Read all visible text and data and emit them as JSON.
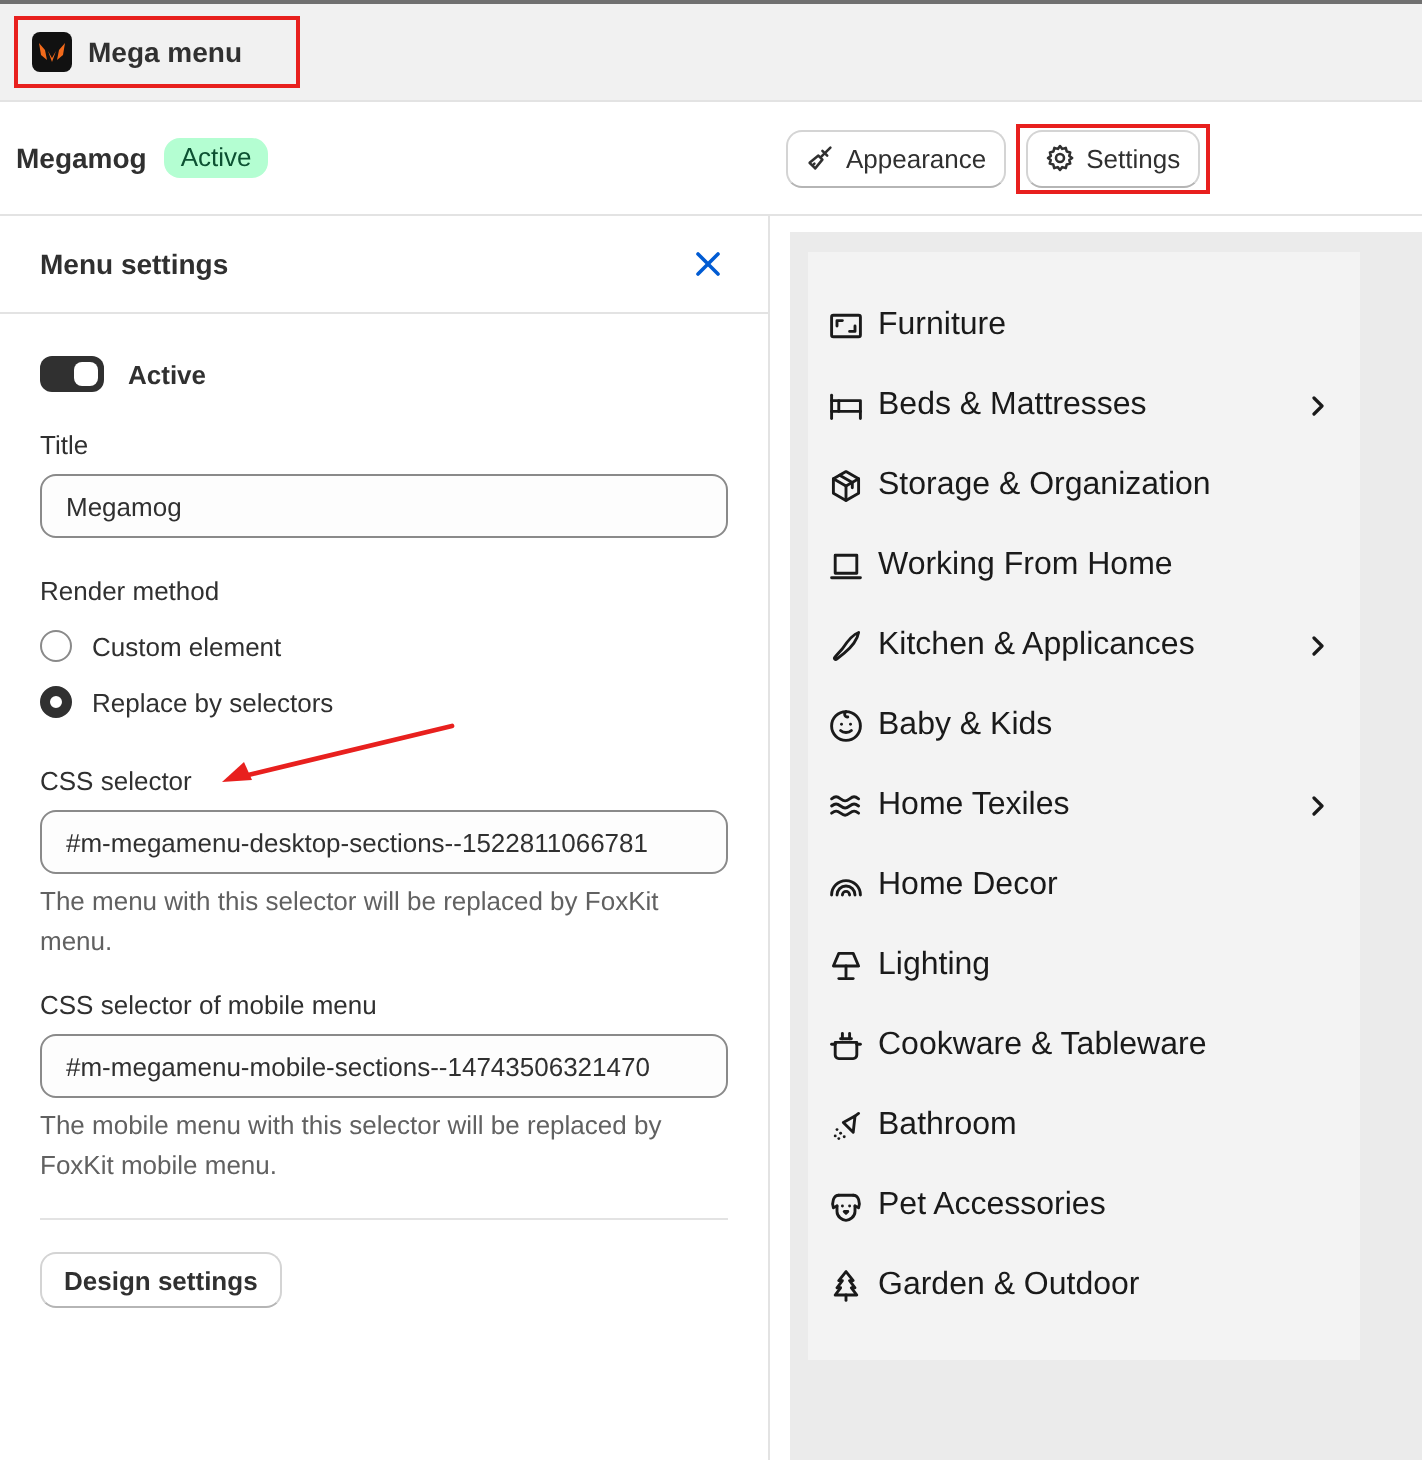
{
  "app_header": {
    "title": "Mega menu",
    "highlighted": true
  },
  "page_header": {
    "title": "Megamog",
    "badge": "Active",
    "buttons": [
      {
        "label": "Appearance",
        "highlighted": false
      },
      {
        "label": "Settings",
        "highlighted": true
      }
    ]
  },
  "settings_panel": {
    "title": "Menu settings",
    "active_toggle": {
      "label": "Active",
      "on": true
    },
    "title_field": {
      "label": "Title",
      "value": "Megamog"
    },
    "render_method": {
      "label": "Render method",
      "options": [
        {
          "label": "Custom element",
          "selected": false
        },
        {
          "label": "Replace by selectors",
          "selected": true
        }
      ]
    },
    "css_selector": {
      "label": "CSS selector",
      "value": "#m-megamenu-desktop-sections--1522811066781",
      "help": "The menu with this selector will be replaced by FoxKit menu.",
      "arrow_callout": true
    },
    "mobile_css_selector": {
      "label": "CSS selector of mobile menu",
      "value": "#m-megamenu-mobile-sections--14743506321470",
      "help": "The mobile menu with this selector will be replaced by FoxKit mobile menu."
    },
    "design_button": "Design settings"
  },
  "menu_preview": {
    "items": [
      {
        "label": "Furniture",
        "has_submenu": false
      },
      {
        "label": "Beds & Mattresses",
        "has_submenu": true
      },
      {
        "label": "Storage & Organization",
        "has_submenu": false
      },
      {
        "label": "Working From Home",
        "has_submenu": false
      },
      {
        "label": "Kitchen & Applicances",
        "has_submenu": true
      },
      {
        "label": "Baby & Kids",
        "has_submenu": false
      },
      {
        "label": "Home Texiles",
        "has_submenu": true
      },
      {
        "label": "Home Decor",
        "has_submenu": false
      },
      {
        "label": "Lighting",
        "has_submenu": false
      },
      {
        "label": "Cookware & Tableware",
        "has_submenu": false
      },
      {
        "label": "Bathroom",
        "has_submenu": false
      },
      {
        "label": "Pet Accessories",
        "has_submenu": false
      },
      {
        "label": "Garden & Outdoor",
        "has_submenu": false
      }
    ]
  }
}
